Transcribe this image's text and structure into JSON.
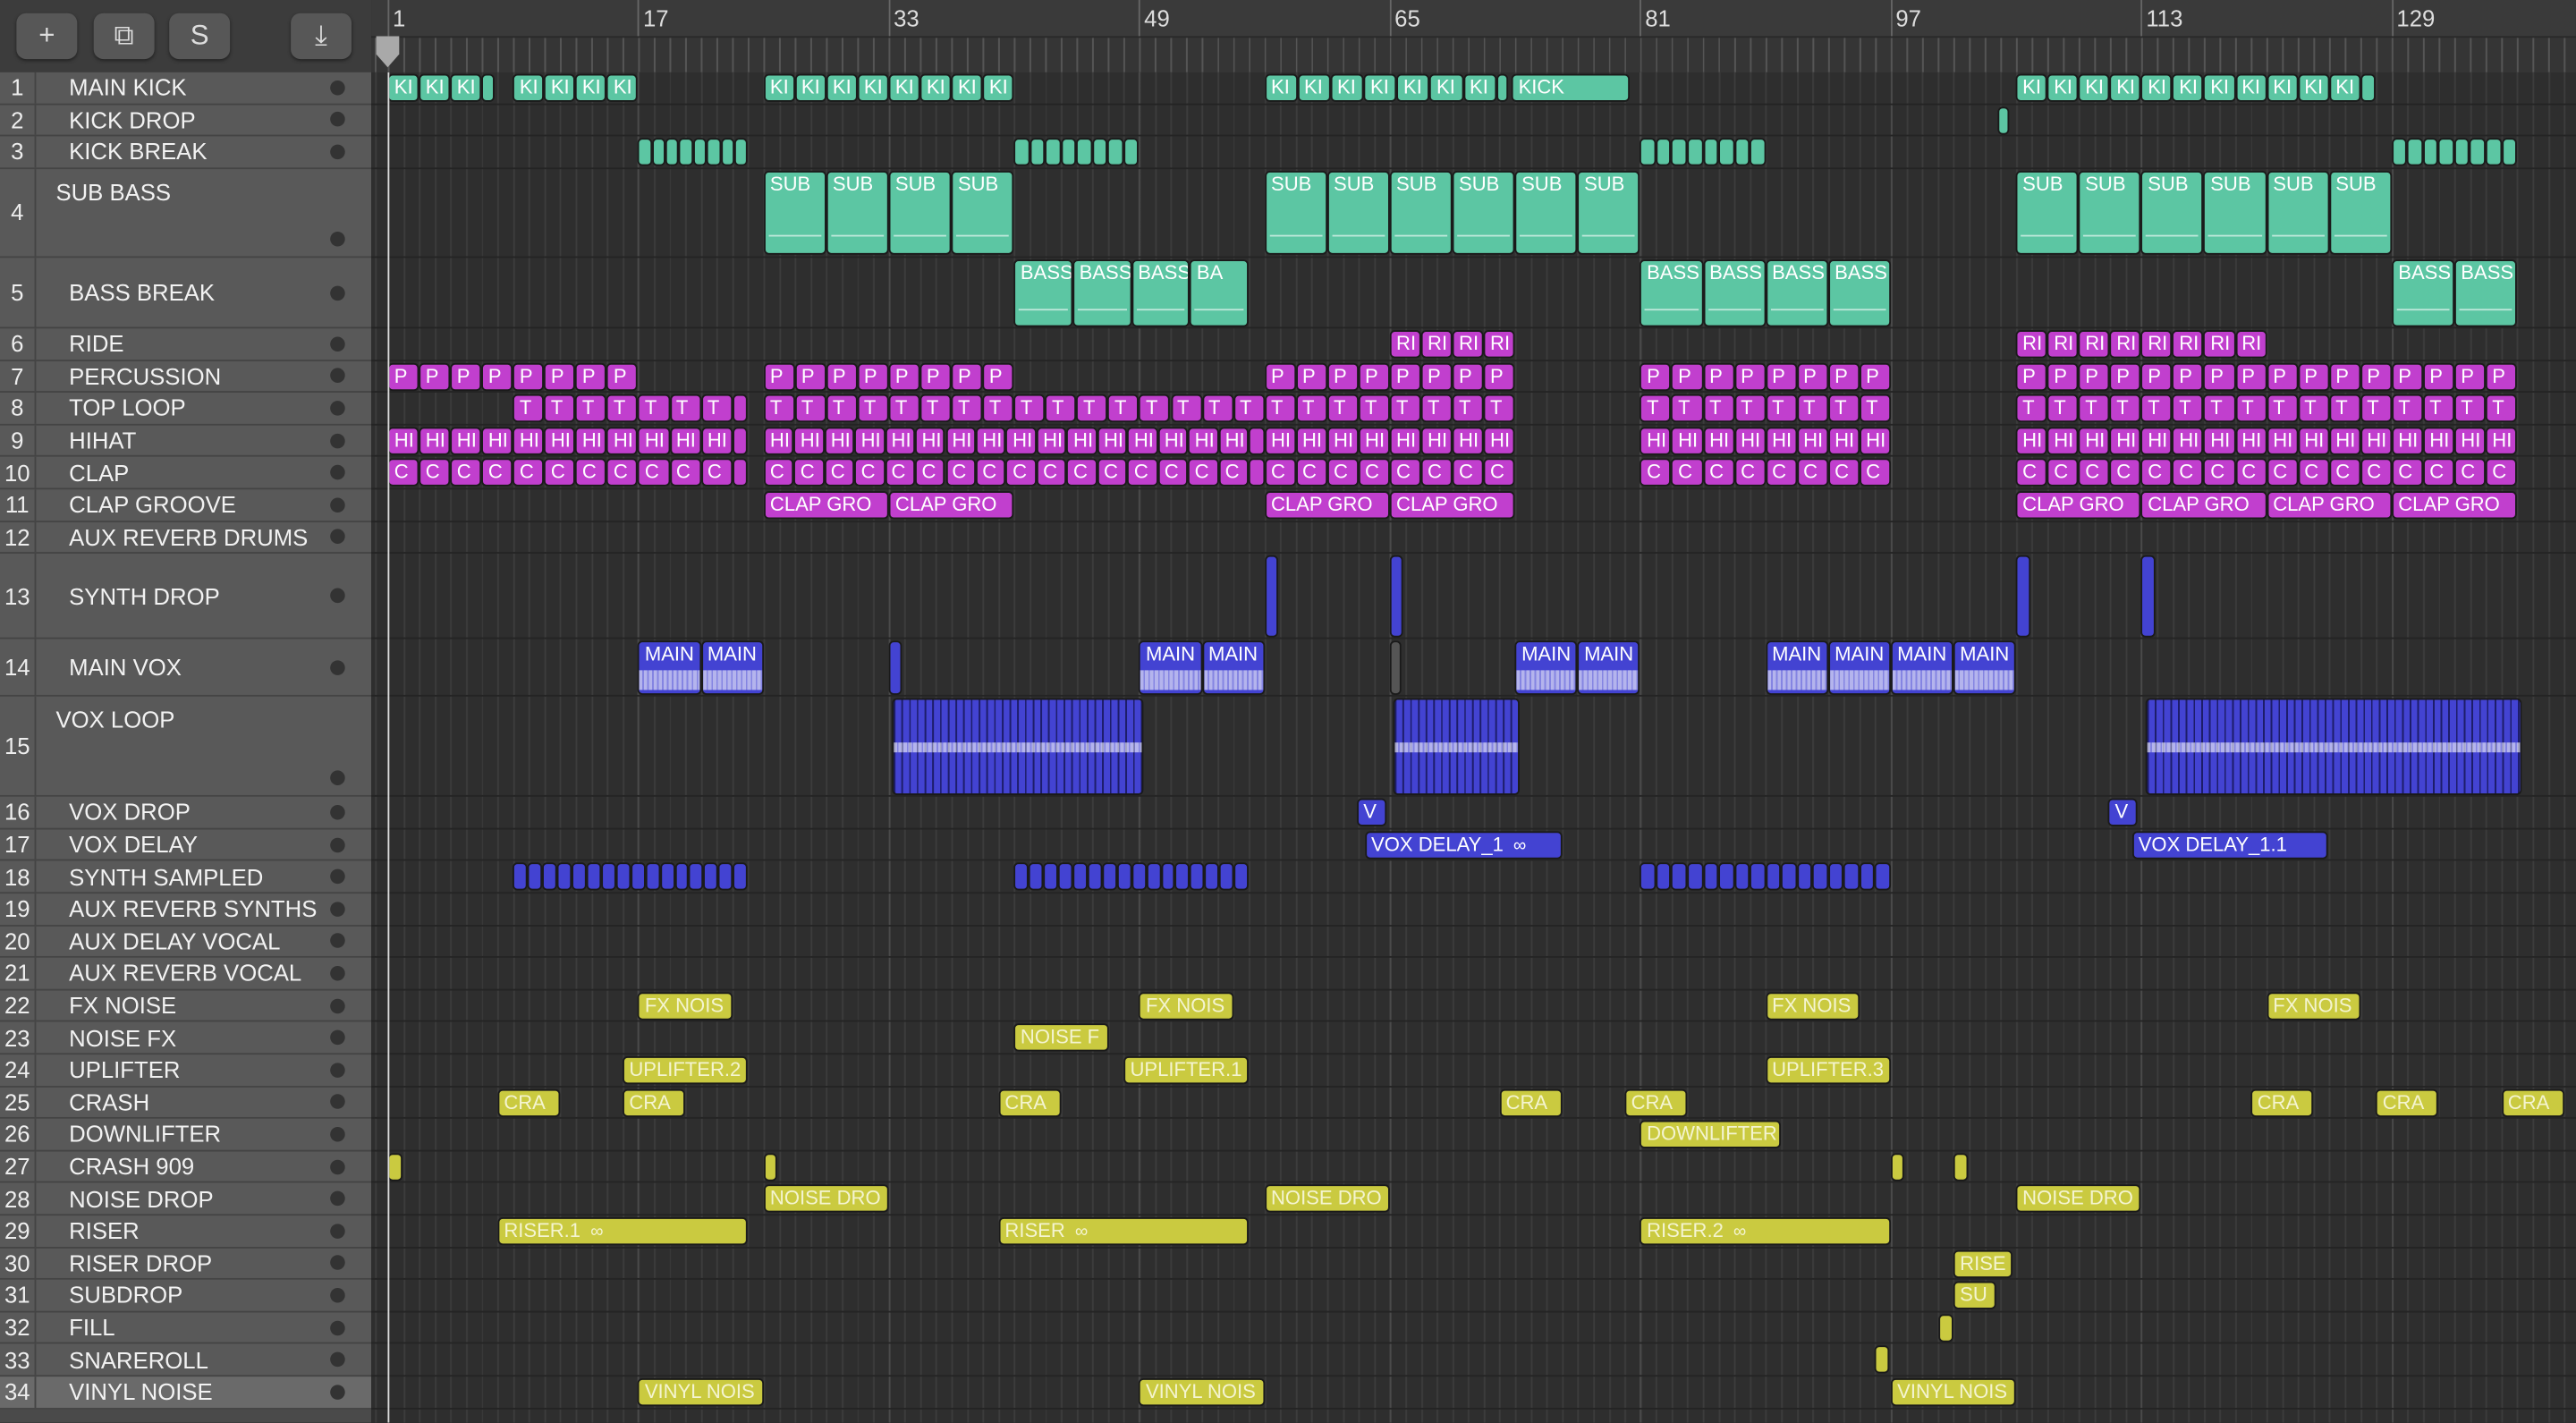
{
  "toolbar": {
    "add_label": "+",
    "duplicate_label": "⧉",
    "s_label": "S",
    "download_label": "⤓"
  },
  "ruler": {
    "bars": [
      "1",
      "17",
      "33",
      "49",
      "65",
      "81",
      "97",
      "113",
      "129"
    ]
  },
  "colors": {
    "teal": "#5cc6a3",
    "magenta": "#c13fce",
    "blue": "#4343d2",
    "yellow": "#caca40",
    "gray": "#555555"
  },
  "tracks": [
    {
      "num": "1",
      "name": "MAIN KICK",
      "color": "teal",
      "regions": [
        [
          1,
          7,
          3,
          "KI"
        ],
        [
          7,
          7.8,
          1,
          ""
        ],
        [
          9,
          17,
          4,
          "KI"
        ],
        [
          25,
          41,
          8,
          "KI"
        ],
        [
          57,
          71.8,
          7,
          "KI"
        ],
        [
          71.8,
          72.6,
          1,
          ""
        ],
        [
          72.8,
          80.3,
          1,
          "KICK"
        ],
        [
          105,
          127,
          11,
          "KI"
        ],
        [
          127,
          128,
          1,
          ""
        ]
      ]
    },
    {
      "num": "2",
      "name": "KICK DROP",
      "color": "teal",
      "regions": [
        [
          103.8,
          104.6,
          1,
          ""
        ]
      ]
    },
    {
      "num": "3",
      "name": "KICK BREAK",
      "color": "teal",
      "regions": [
        [
          17,
          24,
          8,
          ""
        ],
        [
          41,
          49,
          8,
          ""
        ],
        [
          81,
          89,
          8,
          ""
        ],
        [
          129,
          137,
          8,
          ""
        ]
      ]
    },
    {
      "num": "4",
      "name": "SUB BASS",
      "color": "teal",
      "regions": [
        [
          25,
          41,
          4,
          "SUB"
        ],
        [
          57,
          81,
          6,
          "SUB"
        ],
        [
          105,
          129,
          6,
          "SUB"
        ]
      ]
    },
    {
      "num": "5",
      "name": "BASS BREAK",
      "color": "teal",
      "regions": [
        [
          41,
          56,
          4,
          [
            "BASS",
            "BASS",
            "BASS",
            "BA"
          ]
        ],
        [
          81,
          97,
          4,
          "BASS"
        ],
        [
          129,
          137,
          2,
          "BASS"
        ]
      ]
    },
    {
      "num": "6",
      "name": "RIDE",
      "color": "magenta",
      "regions": [
        [
          65,
          73,
          4,
          "RI"
        ],
        [
          105,
          121,
          8,
          "RI"
        ]
      ]
    },
    {
      "num": "7",
      "name": "PERCUSSION",
      "color": "magenta",
      "regions": [
        [
          1,
          17,
          8,
          "P"
        ],
        [
          25,
          41,
          8,
          "P"
        ],
        [
          57,
          73,
          8,
          "P"
        ],
        [
          81,
          97,
          8,
          "P"
        ],
        [
          105,
          137,
          16,
          "P"
        ]
      ]
    },
    {
      "num": "8",
      "name": "TOP LOOP",
      "color": "magenta",
      "regions": [
        [
          9,
          23,
          7,
          "T"
        ],
        [
          23,
          24,
          1,
          ""
        ],
        [
          25,
          57,
          16,
          "T"
        ],
        [
          57,
          73,
          8,
          "T"
        ],
        [
          81,
          97,
          8,
          "T"
        ],
        [
          105,
          137,
          16,
          "T"
        ]
      ]
    },
    {
      "num": "9",
      "name": "HIHAT",
      "color": "magenta",
      "regions": [
        [
          1,
          23,
          11,
          "HI"
        ],
        [
          23,
          24,
          1,
          ""
        ],
        [
          25,
          56,
          16,
          "HI"
        ],
        [
          56,
          57,
          1,
          ""
        ],
        [
          57,
          73,
          8,
          "HI"
        ],
        [
          81,
          97,
          8,
          "HI"
        ],
        [
          105,
          137,
          16,
          "HI"
        ]
      ]
    },
    {
      "num": "10",
      "name": "CLAP",
      "color": "magenta",
      "regions": [
        [
          1,
          23,
          11,
          "C"
        ],
        [
          23,
          24,
          1,
          ""
        ],
        [
          25,
          56,
          16,
          "C"
        ],
        [
          56,
          57,
          1,
          ""
        ],
        [
          57,
          73,
          8,
          "C"
        ],
        [
          81,
          97,
          8,
          "C"
        ],
        [
          105,
          137,
          16,
          "C"
        ]
      ]
    },
    {
      "num": "11",
      "name": "CLAP GROOVE",
      "color": "magenta",
      "regions": [
        [
          25,
          41,
          2,
          "CLAP GRO"
        ],
        [
          57,
          73,
          2,
          "CLAP GRO"
        ],
        [
          105,
          137,
          4,
          "CLAP GRO"
        ]
      ]
    },
    {
      "num": "12",
      "name": "AUX REVERB DRUMS",
      "color": "magenta",
      "regions": []
    },
    {
      "num": "13",
      "name": "SYNTH DROP",
      "color": "blue",
      "regions": [
        [
          57,
          57.9,
          1,
          ""
        ],
        [
          65,
          65.9,
          1,
          ""
        ],
        [
          105,
          105.9,
          1,
          ""
        ],
        [
          113,
          113.9,
          1,
          ""
        ]
      ]
    },
    {
      "num": "14",
      "name": "MAIN VOX",
      "color": "blue",
      "regions": [
        [
          17,
          25,
          2,
          "MAIN"
        ],
        [
          33,
          33.8,
          1,
          ""
        ],
        [
          49,
          57,
          2,
          "MAIN"
        ],
        [
          65,
          65.7,
          1,
          "",
          "gray"
        ],
        [
          73,
          81,
          2,
          "MAIN"
        ],
        [
          89,
          105,
          4,
          "MAIN"
        ]
      ]
    },
    {
      "num": "15",
      "name": "VOX LOOP",
      "color": "blue",
      "regions": [
        [
          33.2,
          49.3,
          1,
          "",
          "stripe"
        ],
        [
          65.2,
          73.3,
          1,
          "",
          "stripe"
        ],
        [
          113.3,
          137.3,
          1,
          "",
          "stripe"
        ]
      ]
    },
    {
      "num": "16",
      "name": "VOX DROP",
      "color": "blue",
      "regions": [
        [
          62.9,
          64.8,
          1,
          "V"
        ],
        [
          110.9,
          112.8,
          1,
          "V"
        ]
      ]
    },
    {
      "num": "17",
      "name": "VOX DELAY",
      "color": "blue",
      "regions": [
        [
          63.4,
          76,
          1,
          "VOX DELAY_1",
          "loop"
        ],
        [
          112.4,
          124.9,
          1,
          "VOX DELAY_1.1"
        ]
      ]
    },
    {
      "num": "18",
      "name": "SYNTH SAMPLED",
      "color": "blue",
      "regions": [
        [
          9,
          24,
          16,
          ""
        ],
        [
          41,
          56,
          16,
          ""
        ],
        [
          81,
          97,
          16,
          ""
        ]
      ]
    },
    {
      "num": "19",
      "name": "AUX REVERB SYNTHS",
      "color": "blue",
      "regions": []
    },
    {
      "num": "20",
      "name": "AUX DELAY VOCAL",
      "color": "blue",
      "regions": []
    },
    {
      "num": "21",
      "name": "AUX REVERB VOCAL",
      "color": "blue",
      "regions": []
    },
    {
      "num": "22",
      "name": "FX NOISE",
      "color": "yellow",
      "regions": [
        [
          17,
          23,
          1,
          "FX NOIS"
        ],
        [
          49,
          55,
          1,
          "FX NOIS"
        ],
        [
          89,
          95,
          1,
          "FX NOIS"
        ],
        [
          121,
          127,
          1,
          "FX NOIS"
        ]
      ]
    },
    {
      "num": "23",
      "name": "NOISE FX",
      "color": "yellow",
      "regions": [
        [
          41,
          47.1,
          1,
          "NOISE F"
        ]
      ]
    },
    {
      "num": "24",
      "name": "UPLIFTER",
      "color": "yellow",
      "regions": [
        [
          16,
          24,
          1,
          "UPLIFTER.2"
        ],
        [
          48,
          56,
          1,
          "UPLIFTER.1"
        ],
        [
          89,
          97,
          1,
          "UPLIFTER.3"
        ]
      ]
    },
    {
      "num": "25",
      "name": "CRASH",
      "color": "yellow",
      "regions": [
        [
          8,
          12,
          1,
          "CRA"
        ],
        [
          16,
          20,
          1,
          "CRA"
        ],
        [
          40,
          44,
          1,
          "CRA"
        ],
        [
          72,
          76,
          1,
          "CRA"
        ],
        [
          80,
          84,
          1,
          "CRA"
        ],
        [
          120,
          124,
          1,
          "CRA"
        ],
        [
          128,
          132,
          1,
          "CRA"
        ],
        [
          136,
          140,
          1,
          "CRA"
        ]
      ]
    },
    {
      "num": "26",
      "name": "DOWNLIFTER",
      "color": "yellow",
      "regions": [
        [
          81,
          90,
          1,
          "DOWNLIFTER"
        ]
      ]
    },
    {
      "num": "27",
      "name": "CRASH 909",
      "color": "yellow",
      "regions": [
        [
          1,
          1.9,
          1,
          ""
        ],
        [
          25,
          25.9,
          1,
          ""
        ],
        [
          97,
          97.9,
          1,
          ""
        ],
        [
          101,
          101.9,
          1,
          ""
        ]
      ]
    },
    {
      "num": "28",
      "name": "NOISE DROP",
      "color": "yellow",
      "regions": [
        [
          25,
          33,
          1,
          "NOISE DRO"
        ],
        [
          57,
          65,
          1,
          "NOISE DRO"
        ],
        [
          105,
          113,
          1,
          "NOISE DRO"
        ]
      ]
    },
    {
      "num": "29",
      "name": "RISER",
      "color": "yellow",
      "regions": [
        [
          8,
          24,
          1,
          "RISER.1",
          "loop"
        ],
        [
          40,
          56,
          1,
          "RISER",
          "loop"
        ],
        [
          81,
          97,
          1,
          "RISER.2",
          "loop"
        ]
      ]
    },
    {
      "num": "30",
      "name": "RISER DROP",
      "color": "yellow",
      "regions": [
        [
          101,
          104.8,
          1,
          "RISE"
        ]
      ]
    },
    {
      "num": "31",
      "name": "SUBDROP",
      "color": "yellow",
      "regions": [
        [
          101,
          103.7,
          1,
          "SU"
        ]
      ]
    },
    {
      "num": "32",
      "name": "FILL",
      "color": "yellow",
      "regions": [
        [
          100.1,
          101,
          1,
          ""
        ]
      ]
    },
    {
      "num": "33",
      "name": "SNAREROLL",
      "color": "yellow",
      "regions": [
        [
          96,
          96.9,
          1,
          ""
        ]
      ]
    },
    {
      "num": "34",
      "name": "VINYL NOISE",
      "color": "yellow",
      "regions": [
        [
          17,
          25,
          1,
          "VINYL NOIS"
        ],
        [
          49,
          57,
          1,
          "VINYL NOIS"
        ],
        [
          97,
          105,
          1,
          "VINYL NOIS"
        ]
      ]
    }
  ]
}
